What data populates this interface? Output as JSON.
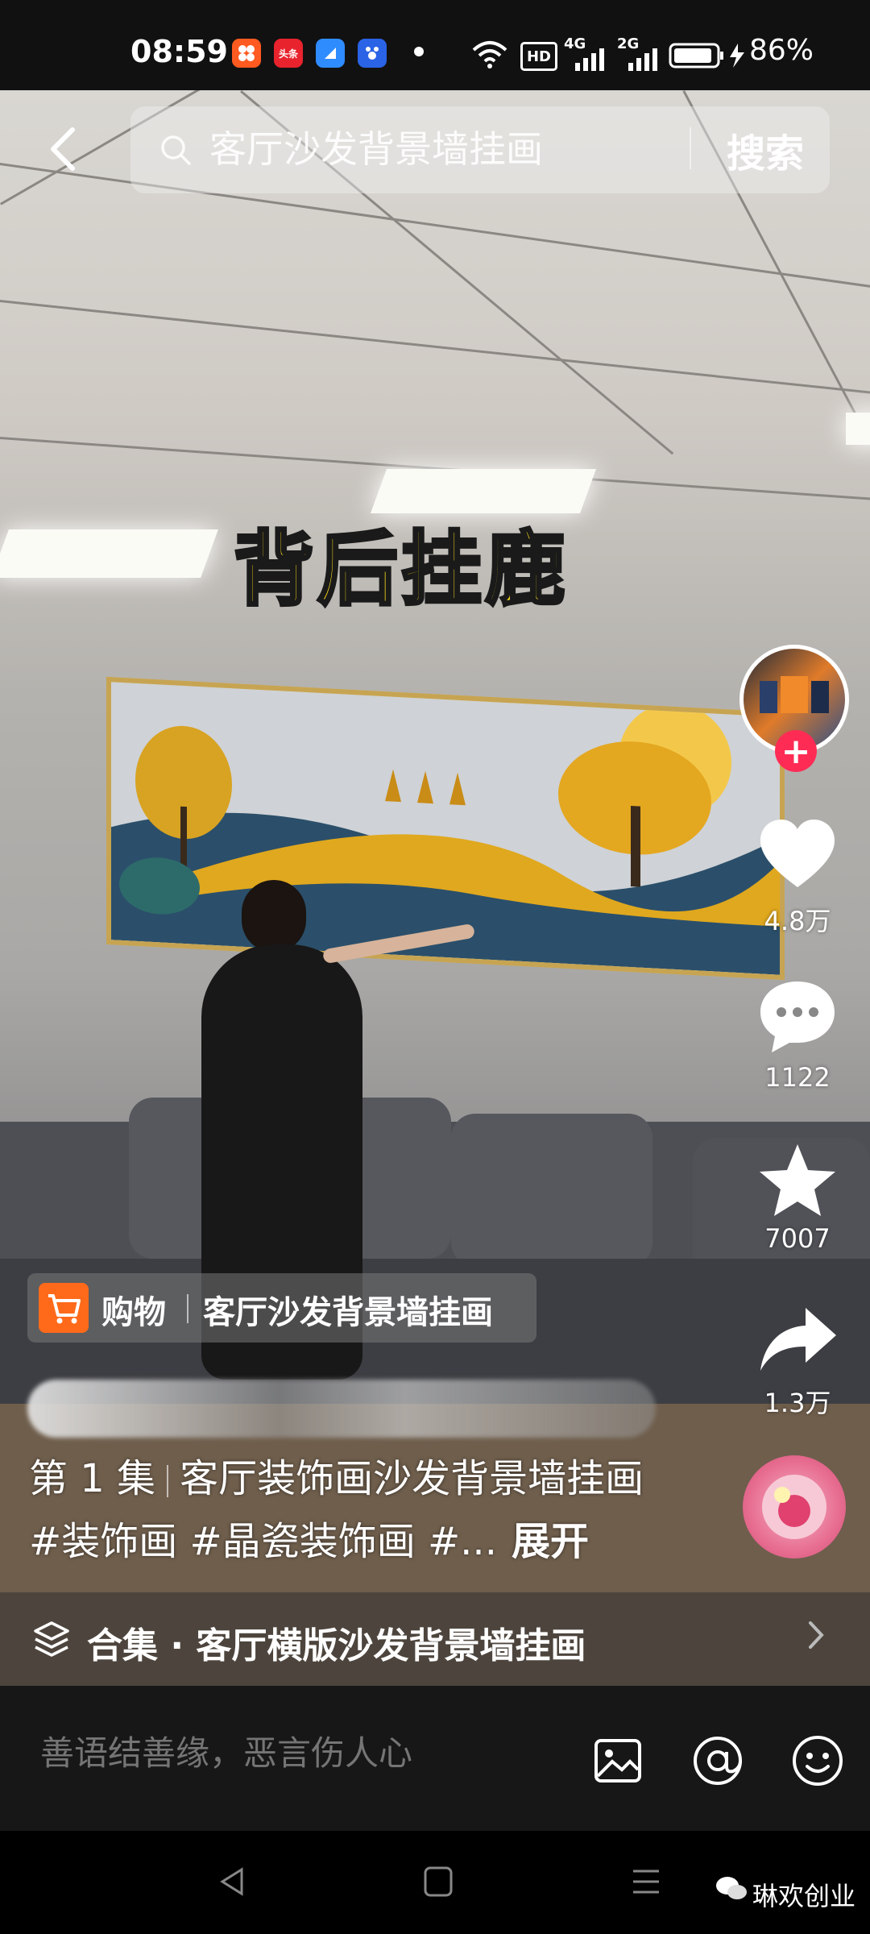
{
  "status_bar": {
    "time": "08:59",
    "apps": [
      "头条"
    ],
    "battery": "86%",
    "network": [
      "HD",
      "4G",
      "2G"
    ]
  },
  "search": {
    "value": "客厅沙发背景墙挂画",
    "button": "搜索"
  },
  "video": {
    "overlay_title": "背后挂鹿"
  },
  "actions": {
    "likes": "4.8万",
    "comments": "1122",
    "favorites": "7007",
    "shares": "1.3万"
  },
  "product": {
    "tag": "购物",
    "name": "客厅沙发背景墙挂画"
  },
  "caption": {
    "episode": "第 1 集",
    "text": "客厅装饰画沙发背景墙挂画#装饰画 #晶瓷装饰画 #...",
    "expand": "展开"
  },
  "collection": {
    "label": "合集 · 客厅横版沙发背景墙挂画"
  },
  "comment_bar": {
    "placeholder": "善语结善缘，恶言伤人心"
  },
  "watermark": {
    "text": "琳欢创业"
  },
  "icons": [
    "back-arrow-icon",
    "search-icon",
    "heart-icon",
    "comment-icon",
    "star-icon",
    "share-icon",
    "collection-icon",
    "image-icon",
    "at-icon",
    "emoji-icon",
    "wechat-icon"
  ],
  "colors": {
    "accent_red": "#fe2c55",
    "cart_orange": "#ff6a1a",
    "title_yellow": "#ffe21a"
  }
}
